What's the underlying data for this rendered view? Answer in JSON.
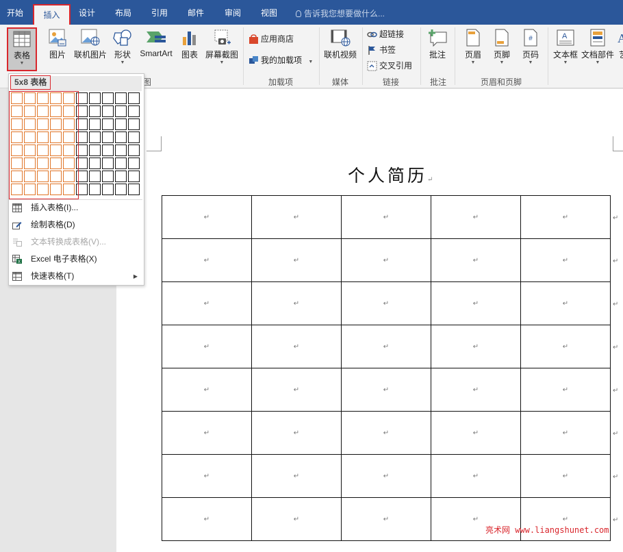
{
  "tabs": [
    "开始",
    "插入",
    "设计",
    "布局",
    "引用",
    "邮件",
    "审阅",
    "视图"
  ],
  "active_tab": "插入",
  "tell_me": "告诉我您想要做什么...",
  "ribbon": {
    "table": "表格",
    "picture": "图片",
    "online_picture": "联机图片",
    "shapes": "形状",
    "smartart": "SmartArt",
    "chart": "图表",
    "screenshot": "屏幕截图",
    "app_store": "应用商店",
    "my_addins": "我的加载项",
    "online_video": "联机视频",
    "hyperlink": "超链接",
    "bookmark": "书签",
    "cross_ref": "交叉引用",
    "comment": "批注",
    "header": "页眉",
    "footer": "页脚",
    "page_number": "页码",
    "textbox": "文本框",
    "doc_parts": "文档部件",
    "more": "艺"
  },
  "groups": {
    "illustrations_tail": "图",
    "addins": "加载项",
    "media": "媒体",
    "links": "链接",
    "comments": "批注",
    "header_footer": "页眉和页脚"
  },
  "table_menu": {
    "grid_label": "5x8 表格",
    "grid_cols": 10,
    "grid_rows": 8,
    "selected_cols": 5,
    "selected_rows": 8,
    "items": [
      {
        "label": "插入表格(I)...",
        "disabled": false
      },
      {
        "label": "绘制表格(D)",
        "disabled": false
      },
      {
        "label": "文本转换成表格(V)...",
        "disabled": true
      },
      {
        "label": "Excel 电子表格(X)",
        "disabled": false
      },
      {
        "label": "快速表格(T)",
        "disabled": false
      }
    ]
  },
  "document": {
    "title": "个人简历",
    "paragraph_mark": "↵",
    "table_rows": 8,
    "table_cols": 5
  },
  "watermark": "亮术网 www.liangshunet.com",
  "colors": {
    "accent_blue": "#2b579a",
    "highlight_red": "#d9262c",
    "grid_selected": "#e07426"
  }
}
